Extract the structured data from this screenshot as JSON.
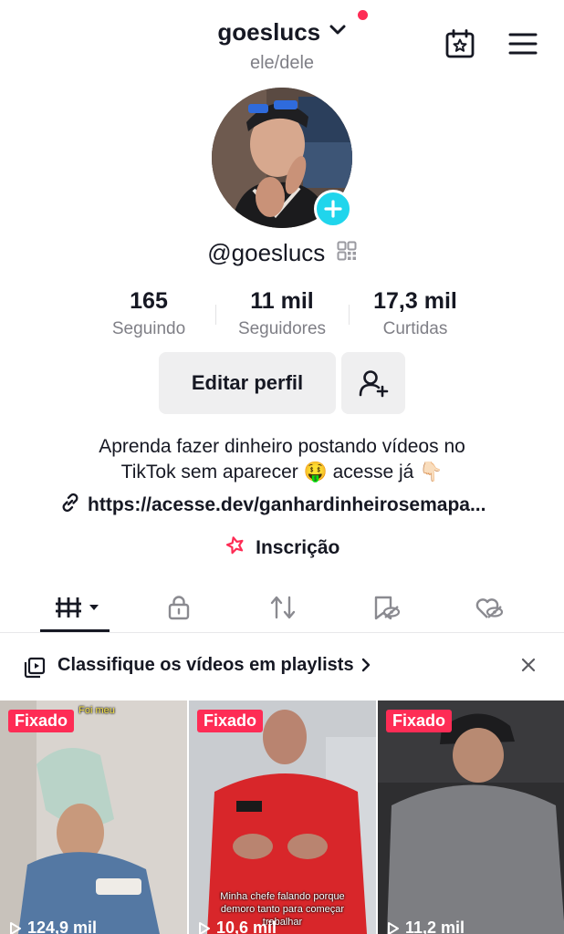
{
  "header": {
    "username": "goeslucs",
    "pronouns": "ele/dele",
    "calendar_icon": "calendar-star-icon",
    "menu_icon": "hamburger-menu-icon"
  },
  "profile": {
    "handle": "@goeslucs",
    "avatar_icon": "profile-photo",
    "add_icon": "plus-icon"
  },
  "stats": [
    {
      "value": "165",
      "label": "Seguindo"
    },
    {
      "value": "11 mil",
      "label": "Seguidores"
    },
    {
      "value": "17,3 mil",
      "label": "Curtidas"
    }
  ],
  "actions": {
    "edit_label": "Editar perfil",
    "add_friend_icon": "add-user-icon"
  },
  "bio": {
    "line1": "Aprenda fazer dinheiro postando vídeos no",
    "line2": "TikTok sem aparecer 🤑 acesse já 👇🏻",
    "link": "https://acesse.dev/ganhardinheirosemapa...",
    "subscription": "Inscrição"
  },
  "tabs": [
    {
      "icon": "videos-grid-icon",
      "active": true
    },
    {
      "icon": "lock-icon",
      "active": false
    },
    {
      "icon": "repost-icon",
      "active": false
    },
    {
      "icon": "saved-hidden-icon",
      "active": false
    },
    {
      "icon": "liked-hidden-icon",
      "active": false
    }
  ],
  "banner": {
    "text": "Classifique os vídeos em playlists",
    "icon": "playlist-icon"
  },
  "videos": [
    {
      "badge": "Fixado",
      "views": "124,9 mil",
      "overlay": "Foi meu"
    },
    {
      "badge": "Fixado",
      "views": "10,6 mil",
      "overlay": "Minha chefe falando porque demoro tanto para começar trabalhar"
    },
    {
      "badge": "Fixado",
      "views": "11,2 mil",
      "overlay": ""
    }
  ],
  "colors": {
    "accent": "#fe2c55",
    "badge_cyan": "#20d5ec",
    "text_primary": "#161823",
    "text_secondary": "#7f7f86",
    "button_bg": "#efeff0"
  }
}
